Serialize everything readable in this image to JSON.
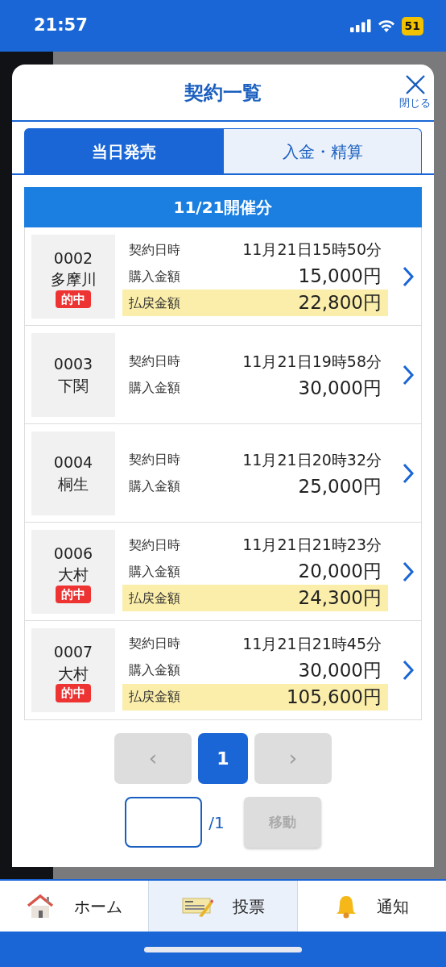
{
  "status_bar": {
    "time": "21:57",
    "battery": "51"
  },
  "modal": {
    "title": "契約一覧",
    "close_label": "閉じる"
  },
  "tabs": [
    {
      "label": "当日発売",
      "selected": true
    },
    {
      "label": "入金・精算",
      "selected": false
    }
  ],
  "date_header": "11/21開催分",
  "contracts": [
    {
      "number": "0002",
      "venue": "多摩川",
      "hit": true,
      "hit_label": "的中",
      "fields": [
        {
          "kind": "plain",
          "label": "契約日時",
          "value": "11月21日15時50分"
        },
        {
          "kind": "amount",
          "label": "購入金額",
          "value": "15,000円"
        },
        {
          "kind": "payout",
          "label": "払戻金額",
          "value": "22,800円"
        }
      ]
    },
    {
      "number": "0003",
      "venue": "下関",
      "hit": false,
      "fields": [
        {
          "kind": "plain",
          "label": "契約日時",
          "value": "11月21日19時58分"
        },
        {
          "kind": "amount",
          "label": "購入金額",
          "value": "30,000円"
        }
      ]
    },
    {
      "number": "0004",
      "venue": "桐生",
      "hit": false,
      "fields": [
        {
          "kind": "plain",
          "label": "契約日時",
          "value": "11月21日20時32分"
        },
        {
          "kind": "amount",
          "label": "購入金額",
          "value": "25,000円"
        }
      ]
    },
    {
      "number": "0006",
      "venue": "大村",
      "hit": true,
      "hit_label": "的中",
      "fields": [
        {
          "kind": "plain",
          "label": "契約日時",
          "value": "11月21日21時23分"
        },
        {
          "kind": "amount",
          "label": "購入金額",
          "value": "20,000円"
        },
        {
          "kind": "payout",
          "label": "払戻金額",
          "value": "24,300円"
        }
      ]
    },
    {
      "number": "0007",
      "venue": "大村",
      "hit": true,
      "hit_label": "的中",
      "fields": [
        {
          "kind": "plain",
          "label": "契約日時",
          "value": "11月21日21時45分"
        },
        {
          "kind": "amount",
          "label": "購入金額",
          "value": "30,000円"
        },
        {
          "kind": "payout",
          "label": "払戻金額",
          "value": "105,600円"
        }
      ]
    }
  ],
  "pagination": {
    "prev": {
      "label": "‹",
      "disabled": true
    },
    "pages": [
      {
        "label": "1",
        "selected": true
      }
    ],
    "next": {
      "label": "›",
      "disabled": true
    }
  },
  "jump": {
    "total": "/1",
    "button": "移動",
    "disabled": true
  },
  "bottom_nav": [
    {
      "kind": "home",
      "label": "ホーム",
      "selected": false
    },
    {
      "kind": "vote",
      "label": "投票",
      "selected": true
    },
    {
      "kind": "bell",
      "label": "通知",
      "selected": false
    }
  ]
}
